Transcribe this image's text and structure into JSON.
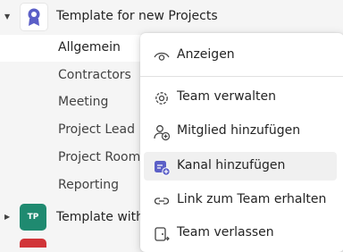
{
  "teams": [
    {
      "name": "Template for new Projects",
      "expanded": true
    },
    {
      "name": "Template with",
      "initials": "TP",
      "expanded": false
    }
  ],
  "channels": [
    {
      "label": "Allgemein",
      "active": true
    },
    {
      "label": "Contractors",
      "active": false
    },
    {
      "label": "Meeting",
      "active": false
    },
    {
      "label": "Project Lead",
      "active": false
    },
    {
      "label": "Project Room",
      "active": false
    },
    {
      "label": "Reporting",
      "active": false
    }
  ],
  "menu": {
    "items": [
      {
        "label": "Anzeigen",
        "icon": "eye-icon"
      },
      {
        "label": "Team verwalten",
        "icon": "gear-icon"
      },
      {
        "label": "Mitglied hinzufügen",
        "icon": "add-person-icon"
      },
      {
        "label": "Kanal hinzufügen",
        "icon": "add-channel-icon"
      },
      {
        "label": "Link zum Team erhalten",
        "icon": "link-icon"
      },
      {
        "label": "Team verlassen",
        "icon": "leave-icon"
      }
    ]
  },
  "colors": {
    "accent": "#5b5fc7",
    "avatar_tp": "#1f8a70",
    "avatar_red": "#d13438"
  }
}
